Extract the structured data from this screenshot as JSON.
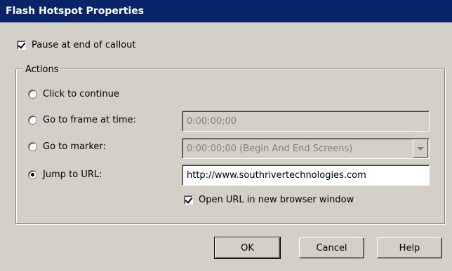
{
  "window": {
    "title": "Flash Hotspot Properties"
  },
  "pause": {
    "label": "Pause at end of callout",
    "checked": true
  },
  "actions": {
    "legend": "Actions",
    "options": [
      {
        "label": "Click to continue",
        "selected": false
      },
      {
        "label": "Go to frame at time:",
        "selected": false
      },
      {
        "label": "Go to marker:",
        "selected": false
      },
      {
        "label": "Jump to URL:",
        "selected": true
      }
    ],
    "frame_time_value": "0:00:00;00",
    "marker_value": "0:00:00;00 (Begin And End Screens)",
    "url_value": "http://www.southrivertechnologies.com",
    "open_new_window": {
      "label": "Open URL in new browser window",
      "checked": true
    }
  },
  "buttons": {
    "ok": "OK",
    "cancel": "Cancel",
    "help": "Help"
  },
  "colors": {
    "titlebar": "#0a246a",
    "face": "#d4d0c8"
  }
}
